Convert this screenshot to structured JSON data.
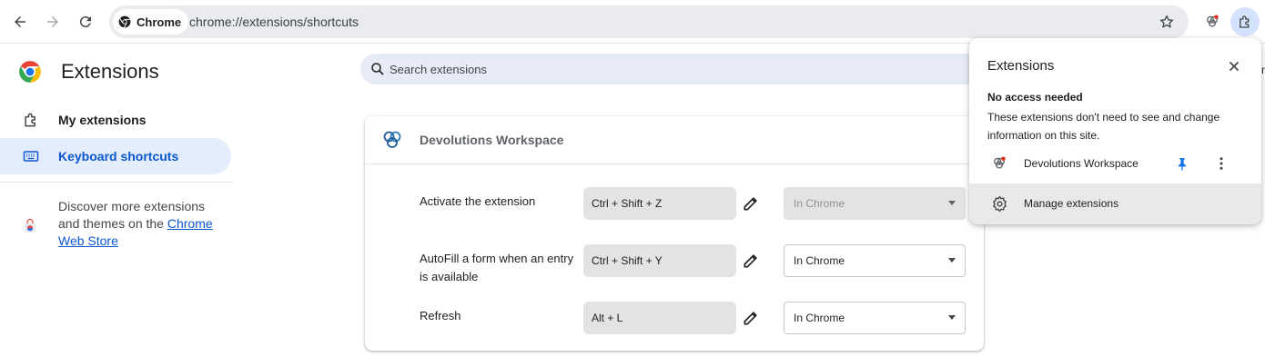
{
  "browser": {
    "chip_label": "Chrome",
    "url": "chrome://extensions/shortcuts"
  },
  "sidebar": {
    "title": "Extensions",
    "items": [
      {
        "label": "My extensions",
        "icon": "puzzle-icon",
        "active": false
      },
      {
        "label": "Keyboard shortcuts",
        "icon": "keyboard-icon",
        "active": true
      }
    ],
    "discover_text": "Discover more extensions and themes on the ",
    "discover_link": "Chrome Web Store"
  },
  "search": {
    "placeholder": "Search extensions"
  },
  "card": {
    "extension_name": "Devolutions Workspace",
    "shortcuts": [
      {
        "command": "Activate the extension",
        "keys": "Ctrl + Shift + Z",
        "scope": "In Chrome",
        "scope_disabled": true
      },
      {
        "command": "AutoFill a form when an entry is available",
        "keys": "Ctrl + Shift + Y",
        "scope": "In Chrome",
        "scope_disabled": false
      },
      {
        "command": "Refresh",
        "keys": "Alt + L",
        "scope": "In Chrome",
        "scope_disabled": false
      }
    ]
  },
  "popup": {
    "title": "Extensions",
    "section_title": "No access needed",
    "section_desc": "These extensions don't need to see and change information on this site.",
    "item_name": "Devolutions Workspace",
    "manage_label": "Manage extensions"
  },
  "edge_fragment": "r",
  "colors": {
    "accent": "#0b57d0",
    "active_nav_bg": "#e4edfb",
    "pin": "#1a73e8"
  }
}
